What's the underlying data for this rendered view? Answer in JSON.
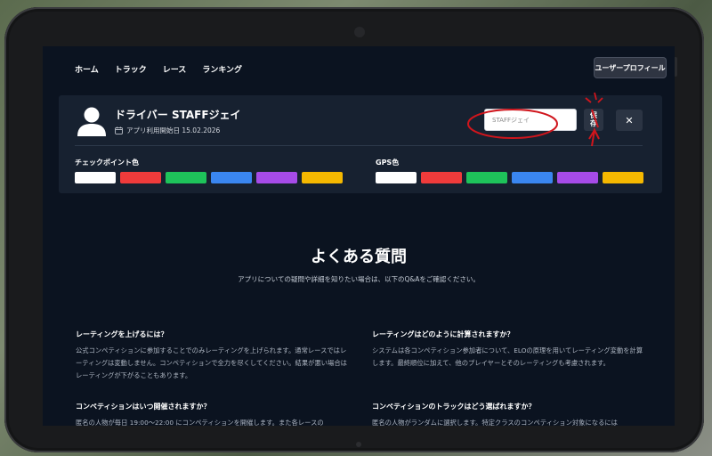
{
  "nav": {
    "links": [
      "ホーム",
      "トラック",
      "レース",
      "ランキング"
    ],
    "profile_button": "ユーザープロフィール"
  },
  "profile": {
    "driver_name": "ドライバー STAFFジェイ",
    "since": "アプリ利用開始日 15.02.2026",
    "name_input_value": "STAFFジェイ",
    "save_label": "保\n存",
    "close_label": "✕",
    "checkpoint_label": "チェックポイント色",
    "gps_label": "GPS色",
    "swatch_colors": [
      "#ffffff",
      "#ef3b3b",
      "#1ec35a",
      "#3a86f0",
      "#a64be8",
      "#f5b800"
    ]
  },
  "faq": {
    "title": "よくある質問",
    "subtitle": "アプリについての疑問や詳細を知りたい場合は、以下のQ&Aをご確認ください。",
    "items": [
      {
        "q": "レーティングを上げるには？",
        "a": "公式コンペティションに参加することでのみレーティングを上げられます。通常レースではレーティングは変動しません。コンペティションで全力を尽くしてください。結果が悪い場合はレーティングが下がることもあります。"
      },
      {
        "q": "レーティングはどのように計算されますか？",
        "a": "システムは各コンペティション参加者について、ELOの原理を用いてレーティング変動を計算します。最終順位に加えて、他のプレイヤーとそのレーティングも考慮されます。"
      },
      {
        "q": "コンペティションはいつ開催されますか？",
        "a": "匿名の人物が毎日 19:00～22:00 にコンペティションを開催します。また各レースの"
      },
      {
        "q": "コンペティションのトラックはどう選ばれますか？",
        "a": "匿名の人物がランダムに選択します。特定クラスのコンペティション対象になるには"
      }
    ]
  },
  "colors": {
    "screen_bg": "#0b1320",
    "card_bg": "#172130",
    "annotation_red": "#d0151c"
  }
}
